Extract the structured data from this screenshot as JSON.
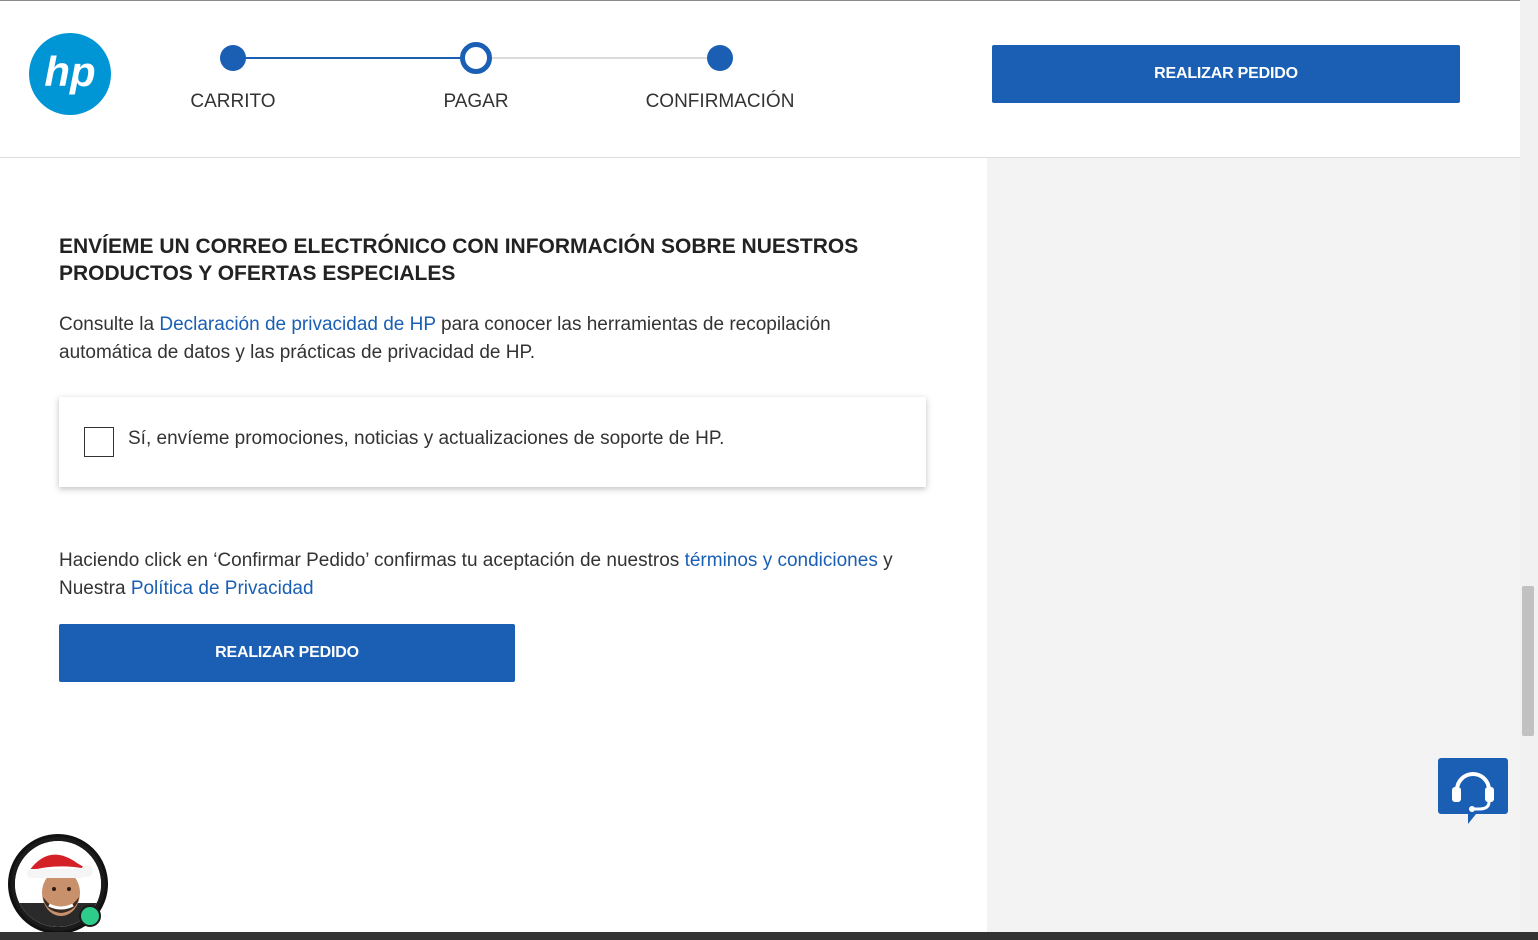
{
  "header": {
    "logo_text": "hp",
    "steps": [
      {
        "label": "CARRITO",
        "state": "done"
      },
      {
        "label": "PAGAR",
        "state": "current"
      },
      {
        "label": "CONFIRMACIÓN",
        "state": "todo"
      }
    ],
    "place_order_label": "REALIZAR PEDIDO"
  },
  "main": {
    "marketing_heading": "ENVÍEME UN CORREO ELECTRÓNICO CON INFORMACIÓN SOBRE NUESTROS PRODUCTOS Y OFERTAS ESPECIALES",
    "privacy_text_before": "Consulte la ",
    "privacy_link": "Declaración de privacidad de HP",
    "privacy_text_after": " para conocer las herramientas de recopilación automática de datos y las prácticas de privacidad de HP.",
    "optin_label": "Sí, envíeme promociones, noticias y actualizaciones de soporte de HP.",
    "optin_checked": false,
    "terms_text_before": "Haciendo click en ‘Confirmar Pedido’ confirmas tu aceptación de nuestros ",
    "terms_link": "términos y condiciones",
    "terms_text_middle": " y Nuestra ",
    "policy_link": "Política de Privacidad",
    "place_order_label": "REALIZAR PEDIDO"
  },
  "widgets": {
    "chat_icon": "headset-chat-icon",
    "agent_avatar_icon": "agent-avatar",
    "agent_status": "online"
  },
  "colors": {
    "brand_blue": "#1a5fb4",
    "logo_blue": "#0096d6",
    "sidebar_bg": "#f3f3f3",
    "online_green": "#2ecc8a"
  }
}
